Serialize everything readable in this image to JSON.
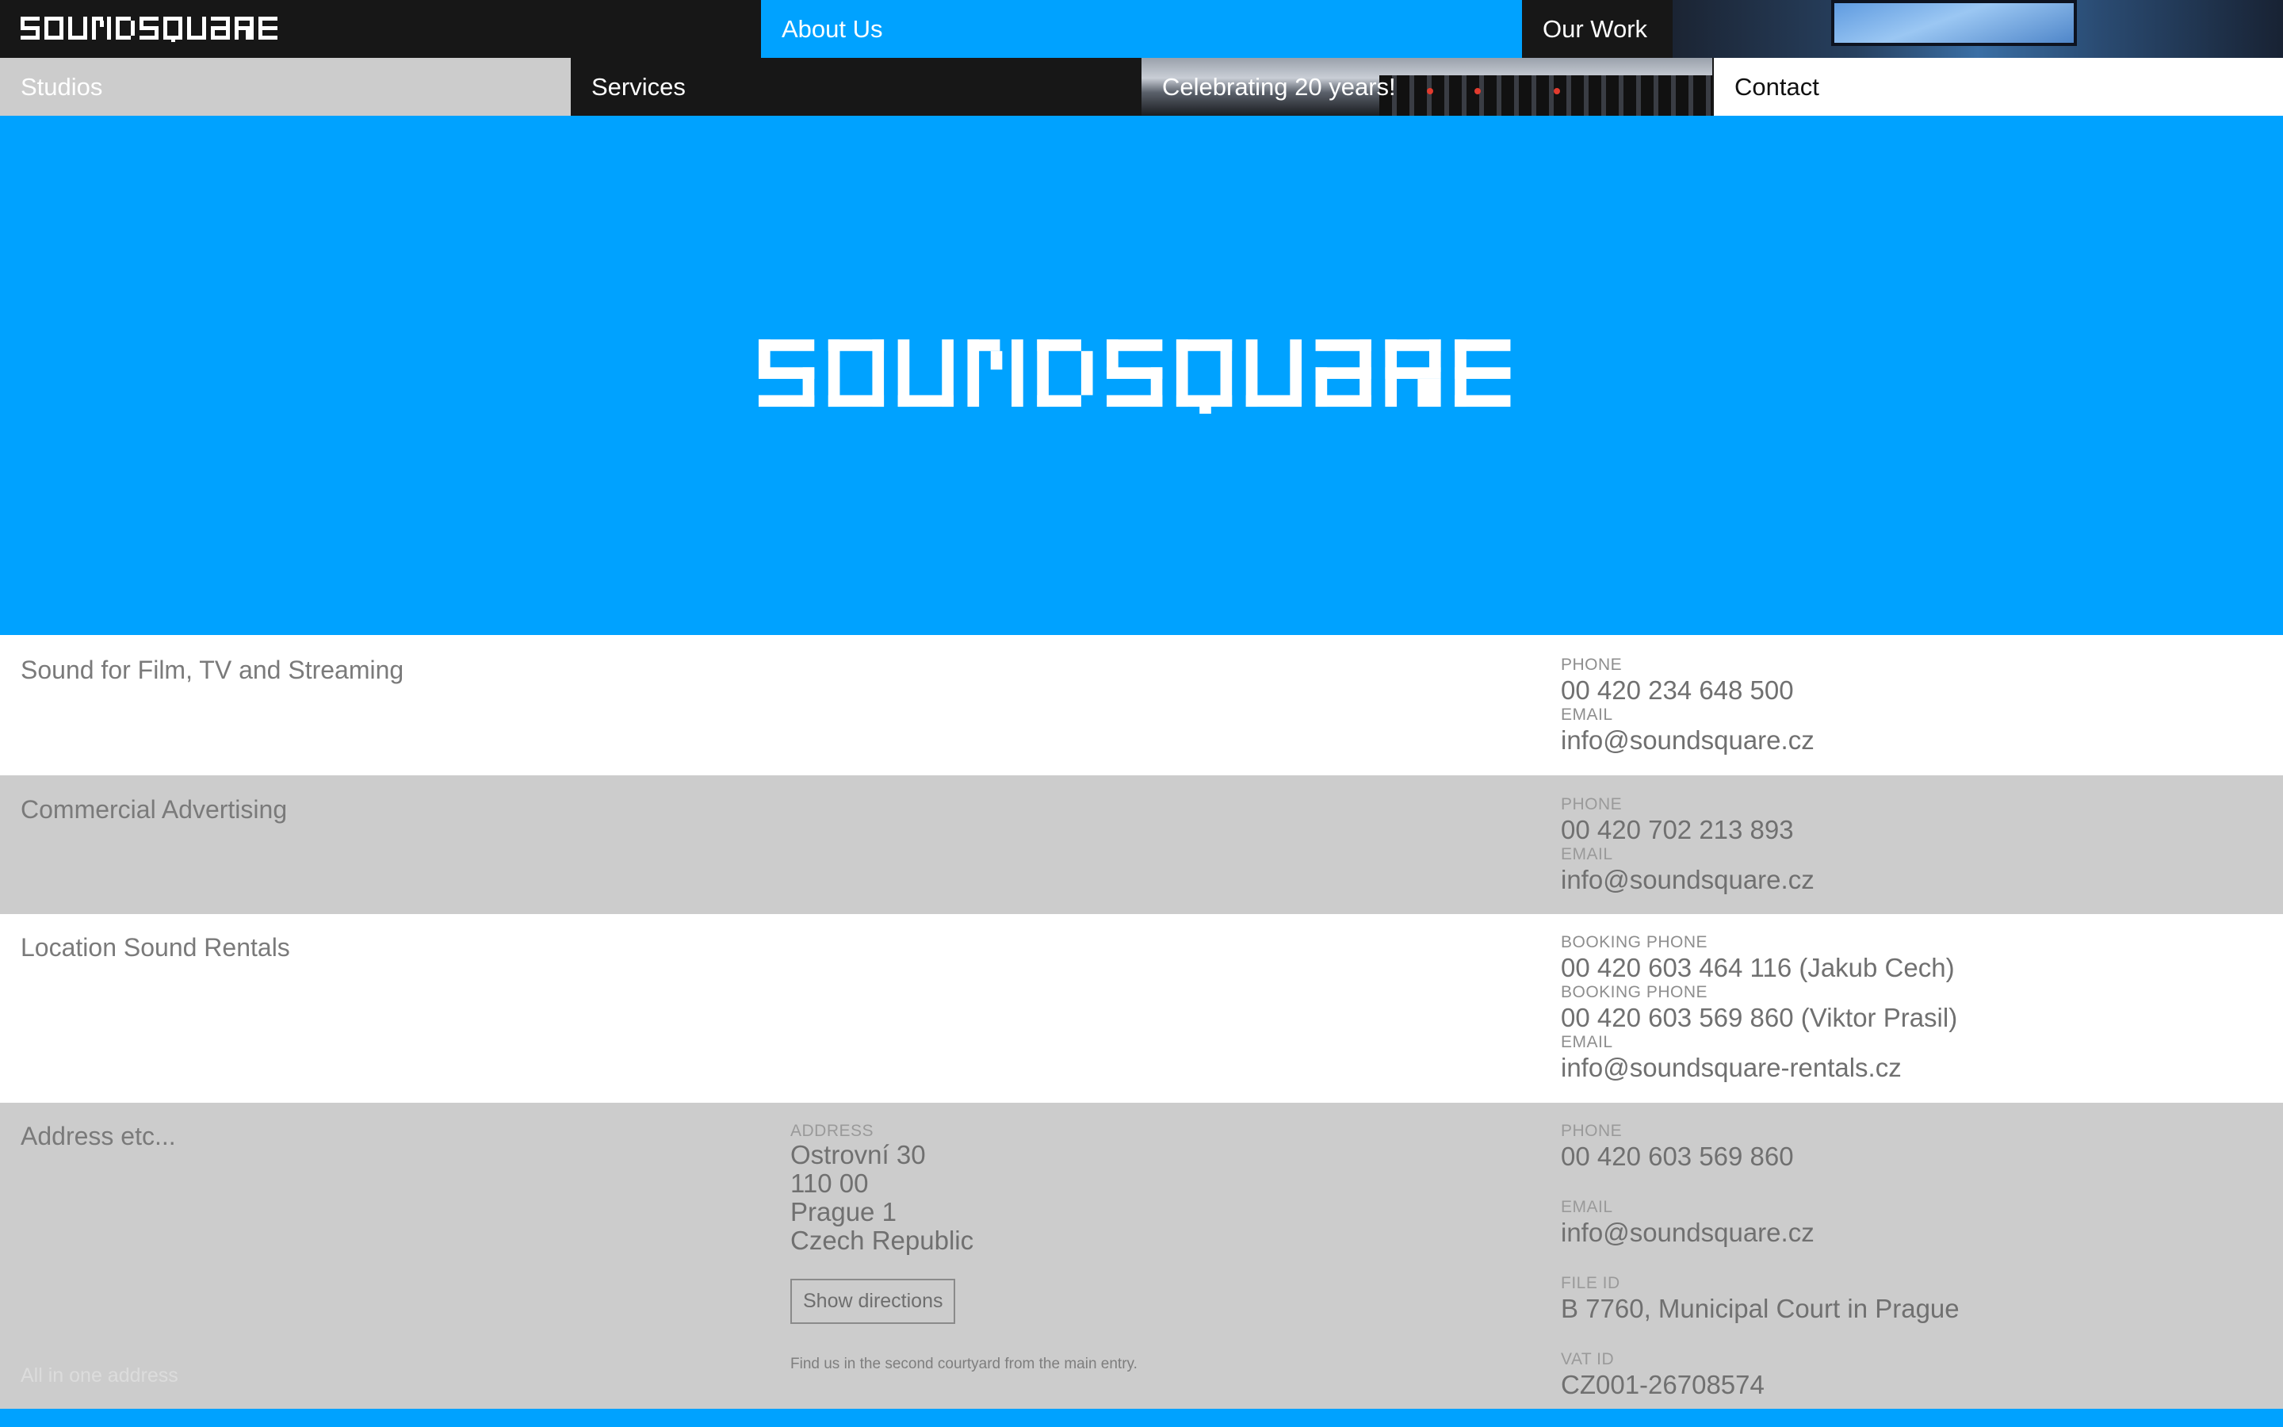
{
  "brand": {
    "logo_text": "SOUNDSQUARE",
    "accent": "#00a2ff",
    "dark": "#171717",
    "grey": "#cccccc"
  },
  "nav": {
    "row1": [
      {
        "label": ""
      },
      {
        "label": "About Us"
      },
      {
        "label": "Our Work"
      }
    ],
    "row2": [
      {
        "label": "Studios"
      },
      {
        "label": "Services"
      },
      {
        "label": "Celebrating 20 years!"
      },
      {
        "label": "Contact"
      }
    ]
  },
  "contacts": [
    {
      "title": "Sound for Film, TV and Streaming",
      "items": [
        {
          "label": "PHONE",
          "value": "00 420 234 648 500"
        },
        {
          "label": "EMAIL",
          "value": "info@soundsquare.cz"
        }
      ]
    },
    {
      "title": "Commercial Advertising",
      "items": [
        {
          "label": "PHONE",
          "value": "00 420 702 213 893"
        },
        {
          "label": "EMAIL",
          "value": "info@soundsquare.cz"
        }
      ]
    },
    {
      "title": "Location Sound Rentals",
      "items": [
        {
          "label": "BOOKING PHONE",
          "value": "00 420 603 464 116 (Jakub Cech)"
        },
        {
          "label": "BOOKING PHONE",
          "value": "00 420 603 569 860 (Viktor Prasil)"
        },
        {
          "label": "EMAIL",
          "value": "info@soundsquare-rentals.cz"
        }
      ]
    }
  ],
  "address_block": {
    "title": "Address etc...",
    "footnote": "All in one address",
    "address_label": "ADDRESS",
    "address_lines": [
      "Ostrovní 30",
      "110 00",
      "Prague 1",
      "Czech Republic"
    ],
    "directions_button": "Show directions",
    "directions_note": "Find us in the second courtyard from the main entry.",
    "items": [
      {
        "label": "PHONE",
        "value": "00 420 603 569 860"
      },
      {
        "label": "EMAIL",
        "value": "info@soundsquare.cz"
      },
      {
        "label": "FILE ID",
        "value": "B 7760, Municipal Court in Prague"
      },
      {
        "label": "VAT ID",
        "value": "CZ001-26708574"
      }
    ]
  }
}
